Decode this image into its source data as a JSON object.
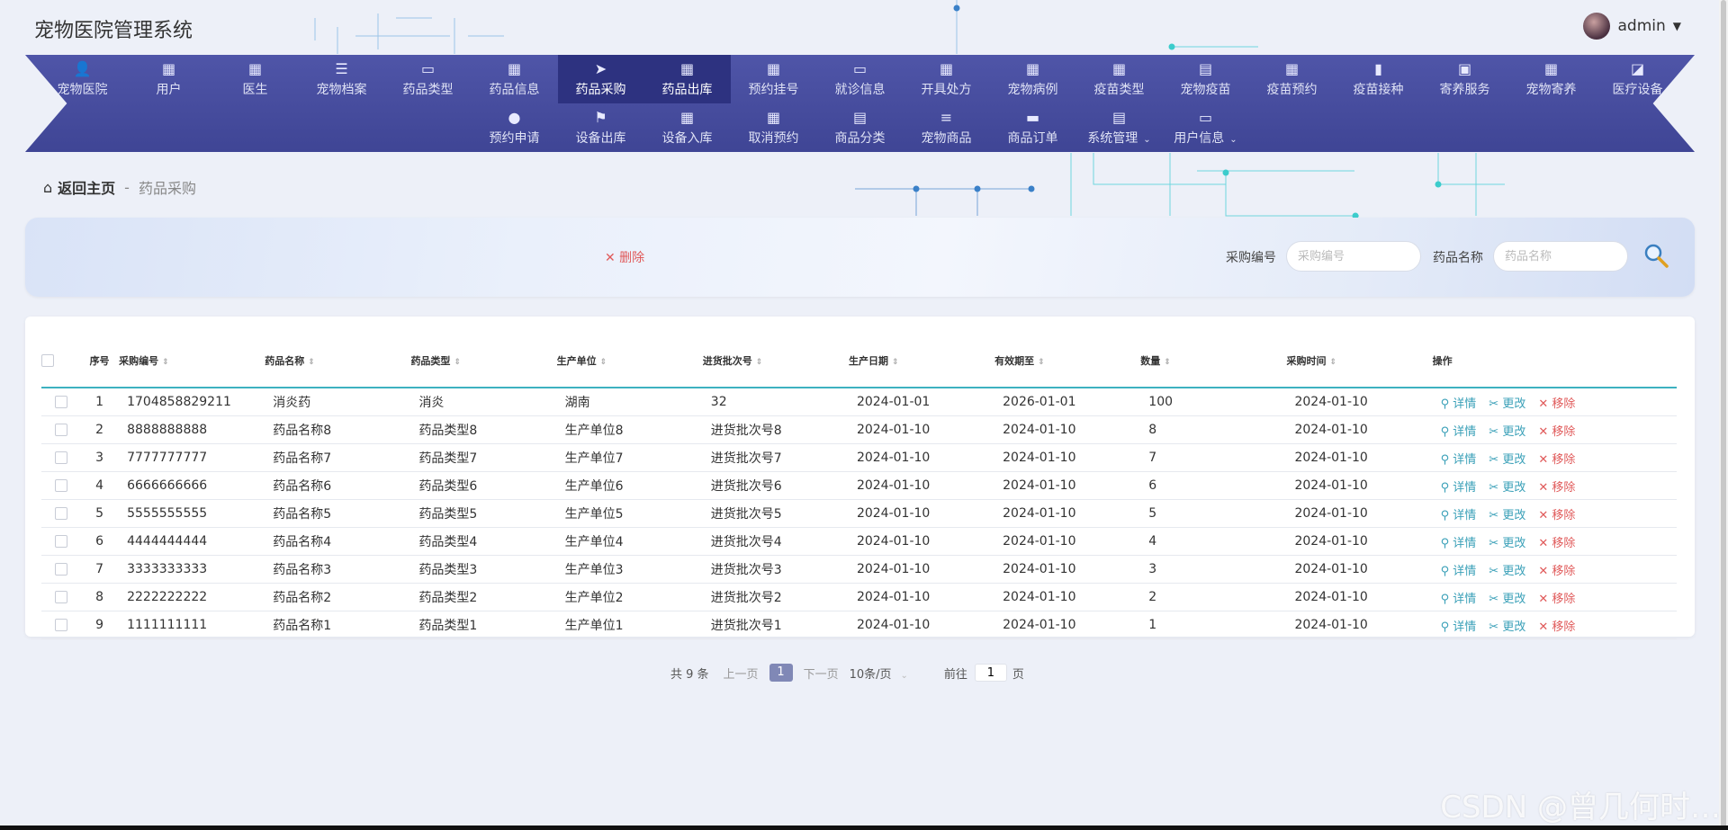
{
  "app": {
    "title": "宠物医院管理系统",
    "user": "admin"
  },
  "nav": {
    "row1": [
      {
        "label": "宠物医院",
        "icon": "user-icon",
        "glyph": "👤"
      },
      {
        "label": "用户",
        "icon": "grid-icon",
        "glyph": "▦"
      },
      {
        "label": "医生",
        "icon": "grid-icon",
        "glyph": "▦"
      },
      {
        "label": "宠物档案",
        "icon": "list-icon",
        "glyph": "☰"
      },
      {
        "label": "药品类型",
        "icon": "monitor-icon",
        "glyph": "▭"
      },
      {
        "label": "药品信息",
        "icon": "grid-icon",
        "glyph": "▦"
      },
      {
        "label": "药品采购",
        "icon": "send-icon",
        "glyph": "➤",
        "active": true
      },
      {
        "label": "药品出库",
        "icon": "grid-icon",
        "glyph": "▦",
        "active": true
      },
      {
        "label": "预约挂号",
        "icon": "grid-icon",
        "glyph": "▦"
      },
      {
        "label": "就诊信息",
        "icon": "monitor-icon",
        "glyph": "▭"
      },
      {
        "label": "开具处方",
        "icon": "grid-icon",
        "glyph": "▦"
      },
      {
        "label": "宠物病例",
        "icon": "grid-icon",
        "glyph": "▦"
      },
      {
        "label": "疫苗类型",
        "icon": "grid-icon",
        "glyph": "▦"
      },
      {
        "label": "宠物疫苗",
        "icon": "clipboard-icon",
        "glyph": "▤"
      },
      {
        "label": "疫苗预约",
        "icon": "grid-icon",
        "glyph": "▦"
      },
      {
        "label": "疫苗接种",
        "icon": "bar-chart-icon",
        "glyph": "▮"
      },
      {
        "label": "寄养服务",
        "icon": "briefcase-icon",
        "glyph": "▣"
      },
      {
        "label": "宠物寄养",
        "icon": "grid-icon",
        "glyph": "▦"
      },
      {
        "label": "医疗设备",
        "icon": "line-chart-icon",
        "glyph": "◪"
      }
    ],
    "row2": [
      {
        "label": "预约申请",
        "icon": "location-pin-icon",
        "glyph": "●"
      },
      {
        "label": "设备出库",
        "icon": "flag-icon",
        "glyph": "⚑"
      },
      {
        "label": "设备入库",
        "icon": "grid-icon",
        "glyph": "▦"
      },
      {
        "label": "取消预约",
        "icon": "grid-icon",
        "glyph": "▦"
      },
      {
        "label": "商品分类",
        "icon": "clipboard-icon",
        "glyph": "▤"
      },
      {
        "label": "宠物商品",
        "icon": "sliders-icon",
        "glyph": "≡"
      },
      {
        "label": "商品订单",
        "icon": "message-icon",
        "glyph": "▬"
      },
      {
        "label": "系统管理",
        "icon": "clipboard-icon",
        "glyph": "▤",
        "dropdown": true
      },
      {
        "label": "用户信息",
        "icon": "card-icon",
        "glyph": "▭",
        "dropdown": true
      }
    ]
  },
  "breadcrumb": {
    "home": "返回主页",
    "sep": "-",
    "current": "药品采购"
  },
  "search": {
    "delete_label": "✕ 删除",
    "field1_label": "采购编号",
    "field1_placeholder": "采购编号",
    "field2_label": "药品名称",
    "field2_placeholder": "药品名称"
  },
  "table": {
    "headers": [
      "序号",
      "采购编号",
      "药品名称",
      "药品类型",
      "生产单位",
      "进货批次号",
      "生产日期",
      "有效期至",
      "数量",
      "采购时间",
      "操作"
    ],
    "sortable": [
      false,
      true,
      true,
      true,
      true,
      true,
      true,
      true,
      true,
      true,
      false
    ],
    "actions": {
      "detail": "⚲ 详情",
      "edit": "✂ 更改",
      "remove": "✕ 移除"
    },
    "rows": [
      [
        "1",
        "1704858829211",
        "消炎药",
        "消炎",
        "湖南",
        "32",
        "2024-01-01",
        "2026-01-01",
        "100",
        "2024-01-10"
      ],
      [
        "2",
        "8888888888",
        "药品名称8",
        "药品类型8",
        "生产单位8",
        "进货批次号8",
        "2024-01-10",
        "2024-01-10",
        "8",
        "2024-01-10"
      ],
      [
        "3",
        "7777777777",
        "药品名称7",
        "药品类型7",
        "生产单位7",
        "进货批次号7",
        "2024-01-10",
        "2024-01-10",
        "7",
        "2024-01-10"
      ],
      [
        "4",
        "6666666666",
        "药品名称6",
        "药品类型6",
        "生产单位6",
        "进货批次号6",
        "2024-01-10",
        "2024-01-10",
        "6",
        "2024-01-10"
      ],
      [
        "5",
        "5555555555",
        "药品名称5",
        "药品类型5",
        "生产单位5",
        "进货批次号5",
        "2024-01-10",
        "2024-01-10",
        "5",
        "2024-01-10"
      ],
      [
        "6",
        "4444444444",
        "药品名称4",
        "药品类型4",
        "生产单位4",
        "进货批次号4",
        "2024-01-10",
        "2024-01-10",
        "4",
        "2024-01-10"
      ],
      [
        "7",
        "3333333333",
        "药品名称3",
        "药品类型3",
        "生产单位3",
        "进货批次号3",
        "2024-01-10",
        "2024-01-10",
        "3",
        "2024-01-10"
      ],
      [
        "8",
        "2222222222",
        "药品名称2",
        "药品类型2",
        "生产单位2",
        "进货批次号2",
        "2024-01-10",
        "2024-01-10",
        "2",
        "2024-01-10"
      ],
      [
        "9",
        "1111111111",
        "药品名称1",
        "药品类型1",
        "生产单位1",
        "进货批次号1",
        "2024-01-10",
        "2024-01-10",
        "1",
        "2024-01-10"
      ]
    ]
  },
  "pagination": {
    "total": "共 9 条",
    "prev": "上一页",
    "current": "1",
    "next": "下一页",
    "page_size": "10条/页",
    "goto_label": "前往",
    "goto_value": "1",
    "goto_suffix": "页"
  },
  "watermark": "CSDN @曾几何时…",
  "colors": {
    "nav": "#464c9e",
    "active_nav": "#2d3280",
    "accent": "#3db1c0",
    "danger": "#e05a5a",
    "link": "#3aa0b8"
  }
}
